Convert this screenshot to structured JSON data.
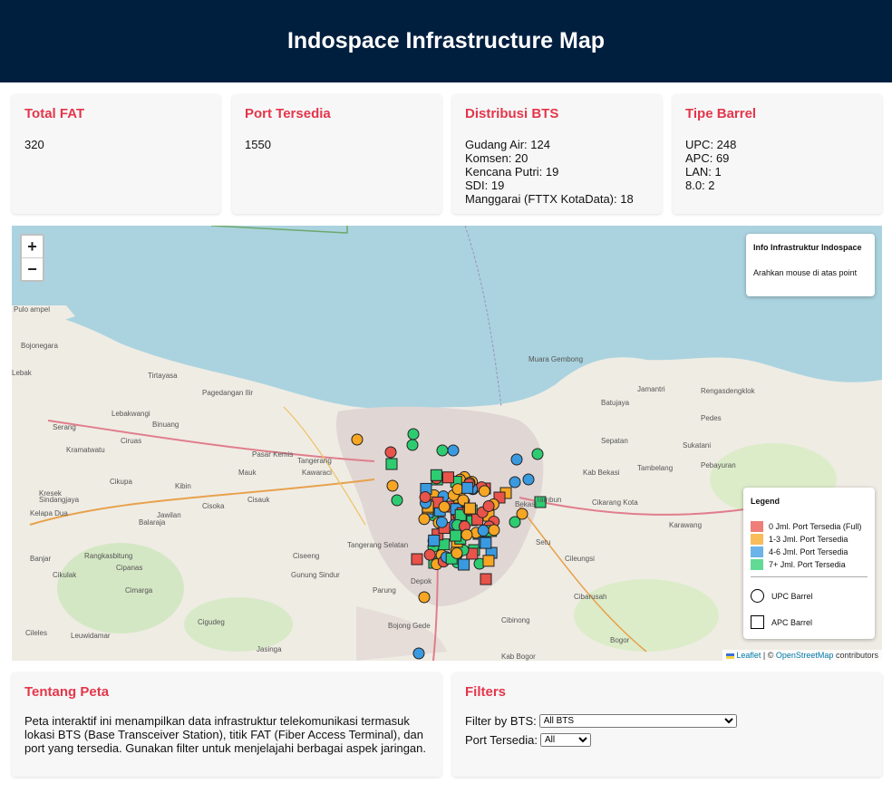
{
  "header": {
    "title": "Indospace Infrastructure Map"
  },
  "stats": {
    "total_fat": {
      "title": "Total FAT",
      "value": "320"
    },
    "port": {
      "title": "Port Tersedia",
      "value": "1550"
    },
    "bts": {
      "title": "Distribusi BTS",
      "lines": [
        "Gudang Air: 124",
        "Komsen: 20",
        "Kencana Putri: 19",
        "SDI: 19",
        "Manggarai (FTTX KotaData): 18"
      ]
    },
    "barrel": {
      "title": "Tipe Barrel",
      "lines": [
        "UPC: 248",
        "APC: 69",
        "LAN: 1",
        "8.0: 2"
      ]
    }
  },
  "map": {
    "zoom_in": "+",
    "zoom_out": "−",
    "info_title": "Info Infrastruktur Indospace",
    "info_hint": "Arahkan mouse di atas point",
    "legend": {
      "title": "Legend",
      "items": [
        {
          "label": "0 Jml. Port Tersedia (Full)",
          "color": "#e8534a"
        },
        {
          "label": "1-3 Jml. Port Tersedia",
          "color": "#f6a623"
        },
        {
          "label": "4-6 Jml. Port Tersedia",
          "color": "#3a9ae0"
        },
        {
          "label": "7+ Jml. Port Tersedia",
          "color": "#2ecc71"
        }
      ],
      "upc": "UPC Barrel",
      "apc": "APC Barrel"
    },
    "attribution": {
      "leaflet": "Leaflet",
      "sep": "| ©",
      "osm": "OpenStreetMap",
      "tail": "contributors"
    },
    "place_labels": [
      "Pulo ampel",
      "Bojonegara",
      "Tirtayasa",
      "Serang",
      "Lebakwangi",
      "Pagedangan Ilir",
      "Binuang",
      "Pasar Kemis",
      "Tangerang",
      "Cikupa",
      "Kawaraci",
      "Tangerang Selatan",
      "Cisoka",
      "Jawilan",
      "Cisauk",
      "Kab Bekasi",
      "Cikarang Kota",
      "Tambun",
      "Bekasi",
      "Sepatan",
      "Sukatani",
      "Jamantri",
      "Pebayuran",
      "Tambelang",
      "Karawang",
      "Cibarusah",
      "Cileungsi",
      "Bogor",
      "Kab Bogor",
      "Ciseeng",
      "Parung",
      "Bojong Gede",
      "Cibinong",
      "Gunung Sindur",
      "Rangkasbitung",
      "Cikulak",
      "Cipanas",
      "Cimarga",
      "Cileles",
      "Leuwidamar",
      "Depok",
      "Setu",
      "Muara Gembong",
      "Batujaya",
      "Pedes",
      "Rengasdengklok",
      "Kelapa Dua",
      "Cigudeg",
      "Jasinga",
      "Banjar",
      "Kibin",
      "Balaraja",
      "Kresek",
      "Mauk",
      "Sindangjaya",
      "Ciruas",
      "Kramatwatu",
      "Lebak"
    ]
  },
  "about": {
    "title": "Tentang Peta",
    "text": "Peta interaktif ini menampilkan data infrastruktur telekomunikasi termasuk lokasi BTS (Base Transceiver Station), titik FAT (Fiber Access Terminal), dan port yang tersedia. Gunakan filter untuk menjelajahi berbagai aspek jaringan."
  },
  "filters": {
    "title": "Filters",
    "bts_label": "Filter by BTS:",
    "bts_value": "All BTS",
    "port_label": "Port Tersedia:",
    "port_value": "All"
  }
}
